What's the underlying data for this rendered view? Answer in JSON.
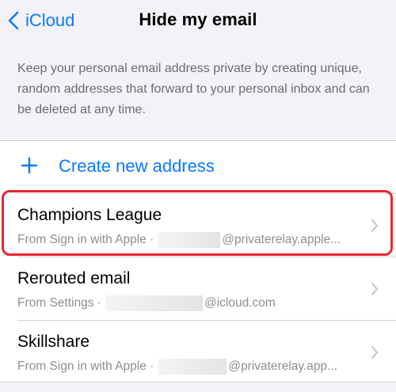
{
  "nav": {
    "back_label": "iCloud",
    "title": "Hide my email"
  },
  "description": "Keep your personal email address private by creating unique, random addresses that forward to your personal inbox and can be deleted at any time.",
  "create": {
    "label": "Create new address"
  },
  "rows": [
    {
      "name": "Champions League",
      "source": "From Sign in with Apple ·",
      "domain": "@privaterelay.apple..."
    },
    {
      "name": "Rerouted email",
      "source": "From Settings ·",
      "domain": "@icloud.com"
    },
    {
      "name": "Skillshare",
      "source": "From Sign in with Apple ·",
      "domain": "@privaterelay.app..."
    }
  ],
  "colors": {
    "accent": "#0a7aff",
    "highlight": "#e8262e",
    "background": "#f2f2f7"
  },
  "icons": {
    "back": "chevron-left-icon",
    "add": "plus-icon",
    "row": "chevron-right-icon"
  }
}
